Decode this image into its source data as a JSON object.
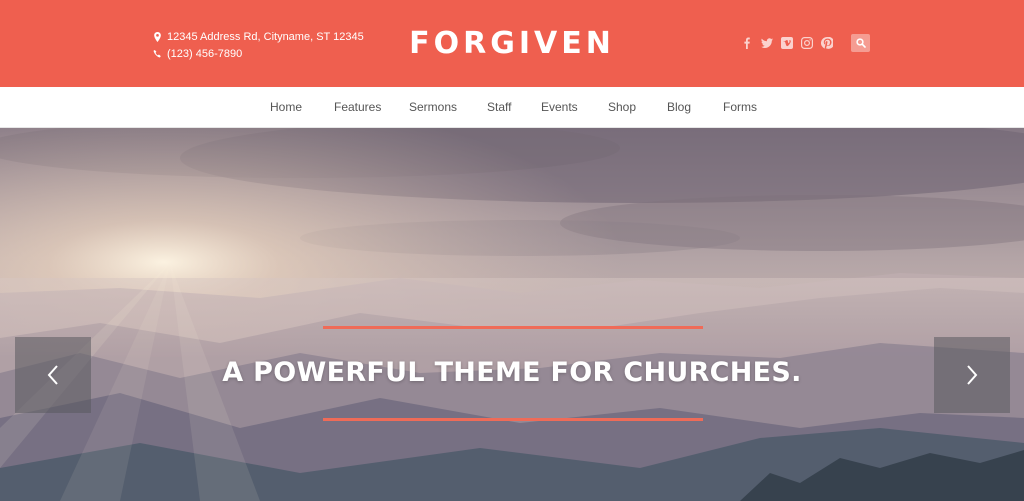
{
  "header": {
    "address": "12345 Address Rd, Cityname, ST 12345",
    "phone": "(123) 456-7890",
    "logo": "FORGIVEN",
    "social_icons": [
      "facebook-icon",
      "twitter-icon",
      "vimeo-icon",
      "instagram-icon",
      "pinterest-icon"
    ],
    "search_icon": "search-icon",
    "background_color": "#ef5f4f"
  },
  "nav": {
    "items": [
      {
        "label": "Home"
      },
      {
        "label": "Features"
      },
      {
        "label": "Sermons"
      },
      {
        "label": "Staff"
      },
      {
        "label": "Events"
      },
      {
        "label": "Shop"
      },
      {
        "label": "Blog"
      },
      {
        "label": "Forms"
      }
    ]
  },
  "hero": {
    "title": "A POWERFUL THEME FOR CHURCHES.",
    "prev_icon": "chevron-left-icon",
    "next_icon": "chevron-right-icon",
    "accent_color": "#ef6b58"
  }
}
